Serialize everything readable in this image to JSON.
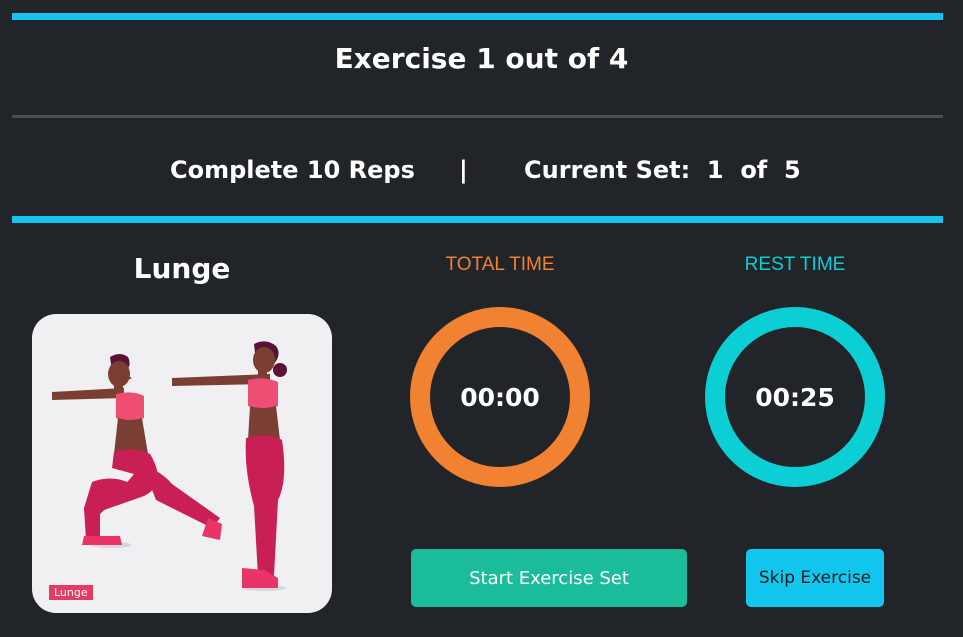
{
  "header": {
    "title": "Exercise 1 out of 4"
  },
  "status": {
    "reps": "Complete 10 Reps",
    "separator": "|",
    "current_set": "Current Set:  1  of  5"
  },
  "exercise": {
    "name": "Lunge",
    "image_tag": "Lunge",
    "image_icon": "lunge-illustration"
  },
  "timers": {
    "total": {
      "label": "TOTAL TIME",
      "value": "00:00",
      "color": "#f08232"
    },
    "rest": {
      "label": "REST TIME",
      "value": "00:25",
      "color": "#0ccfd6"
    }
  },
  "buttons": {
    "start": {
      "label": "Start Exercise Set",
      "color": "#1abc9c"
    },
    "skip": {
      "label": "Skip Exercise",
      "color": "#11c7ef"
    }
  },
  "colors": {
    "background": "#212428",
    "accent_bar": "#16c4f0",
    "divider": "#4b4f54"
  }
}
